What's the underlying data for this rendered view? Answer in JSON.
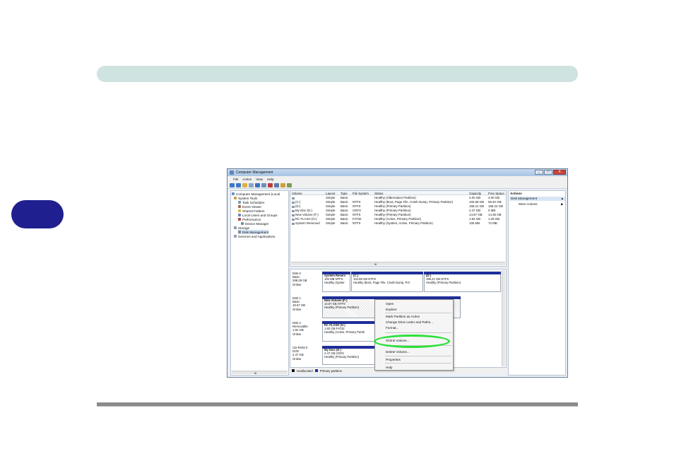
{
  "window": {
    "title": "Computer Management",
    "controls": [
      "_",
      "□",
      "X"
    ]
  },
  "menu": [
    "File",
    "Action",
    "View",
    "Help"
  ],
  "tree": {
    "items": [
      "Computer Management (Local",
      "System Tools",
      "Task Scheduler",
      "Event Viewer",
      "Shared Folders",
      "Local Users and Groups",
      "Performance",
      "Device Manager",
      "Storage",
      "Disk Management",
      "Services and Applications"
    ],
    "scroll": "III"
  },
  "volumes": {
    "columns": [
      "Volume",
      "Layout",
      "Type",
      "File System",
      "Status",
      "Capacity",
      "Free Space"
    ],
    "rows": [
      [
        "",
        "Simple",
        "Basic",
        "",
        "Healthy (Hibernation Partition)",
        "4.00 GB",
        "4.00 GB"
      ],
      [
        "(C:)",
        "Simple",
        "Basic",
        "NTFS",
        "Healthy (Boot, Page File, Crash Dump, Primary Partition)",
        "102.68 GB",
        "59.40 GB"
      ],
      [
        "(D:)",
        "Simple",
        "Basic",
        "NTFS",
        "Healthy (Primary Partition)",
        "155.21 GB",
        "155.22 GB"
      ],
      [
        "My Disc (E:)",
        "Simple",
        "Basic",
        "CDFS",
        "Healthy (Primary Partition)",
        "2.47 GB",
        "0 MB"
      ],
      [
        "New Volume (F:)",
        "Simple",
        "Basic",
        "NTFS",
        "Healthy (Primary Partition)",
        "14.67 GB",
        "14.36 GB"
      ],
      [
        "RC FLASH (G:)",
        "Simple",
        "Basic",
        "FAT32",
        "Healthy (Active, Primary Partition)",
        "1.82 GB",
        "1.29 GB"
      ],
      [
        "System Reserved",
        "Simple",
        "Basic",
        "NTFS",
        "Healthy (System, Active, Primary Partition)",
        "100 MB",
        "72 MB"
      ]
    ],
    "scroll": "III"
  },
  "disks": [
    {
      "name": "Disk 0",
      "type": "Basic",
      "size": "298.09 GB",
      "status": "Online",
      "parts": [
        {
          "title": "System Reserv",
          "size": "100 MB NTFS",
          "status": "Healthy (Syster"
        },
        {
          "title": "(C:)",
          "size": "102.88 GB NTFS",
          "status": "Healthy (Boot, Page File, Crash Dump, Prir"
        },
        {
          "title": "(D:)",
          "size": "195.21 GB NTFS",
          "status": "Healthy (Primary Partition)"
        }
      ]
    },
    {
      "name": "Disk 1",
      "type": "Basic",
      "size": "18.67 GB",
      "status": "Online",
      "parts": [
        {
          "title": "New Volume (F:)",
          "size": "14.67 GB NTFS",
          "status": "Healthy (Primary Partition)"
        }
      ]
    },
    {
      "name": "Disk 2",
      "type": "Removable",
      "size": "1.92 GB",
      "status": "Online",
      "parts": [
        {
          "title": "RC FLASH (G:)",
          "size": "1.82 GB FAT32",
          "status": "Healthy (Active, Primary Partiti"
        }
      ]
    },
    {
      "name": "CD-ROM 0",
      "type": "DVD",
      "size": "2.47 GB",
      "status": "Online",
      "parts": [
        {
          "title": "My Disc (E:)",
          "size": "2.47 GB CDFS",
          "status": "Healthy (Primary Partition)"
        }
      ]
    }
  ],
  "legend": [
    "Unallocated",
    "Primary partition"
  ],
  "actions": {
    "header": "Actions",
    "selected": "Disk Management",
    "more": "More Actions"
  },
  "context_menu": [
    "Open",
    "Explore",
    "Mark Partition as Active",
    "Change Drive Letter and Paths...",
    "Format...",
    "Shrink Volume...",
    "Delete Volume...",
    "Properties",
    "Help"
  ],
  "colors": {
    "accent_bar": "#cfe3e1",
    "tab": "#1f1f8f",
    "partition_cap": "#1d2e99",
    "highlight": "#2ee03a"
  }
}
